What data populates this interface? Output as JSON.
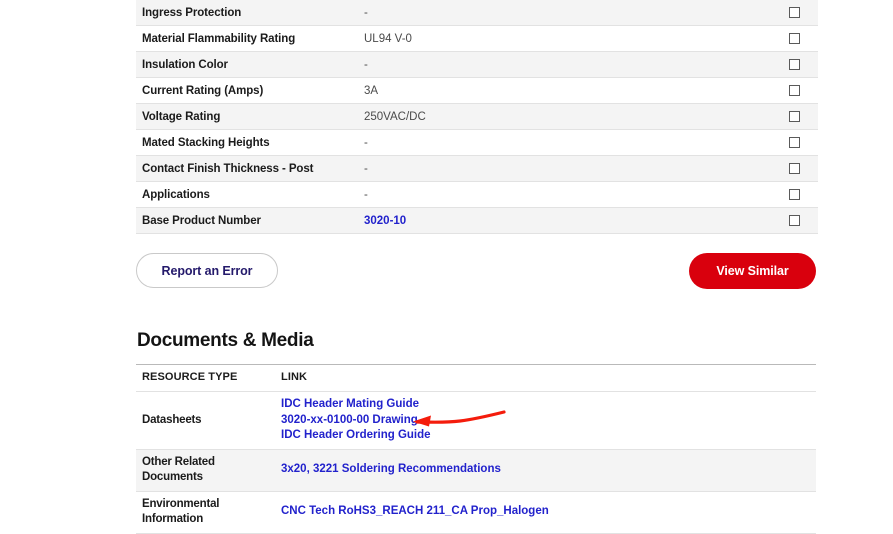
{
  "specifications": {
    "checkbox_icon": "checkbox-unchecked-icon",
    "rows": [
      {
        "label": "Ingress Protection",
        "value": "-",
        "is_link": false
      },
      {
        "label": "Material Flammability Rating",
        "value": "UL94 V-0",
        "is_link": false
      },
      {
        "label": "Insulation Color",
        "value": "-",
        "is_link": false
      },
      {
        "label": "Current Rating (Amps)",
        "value": "3A",
        "is_link": false
      },
      {
        "label": "Voltage Rating",
        "value": "250VAC/DC",
        "is_link": false
      },
      {
        "label": "Mated Stacking Heights",
        "value": "-",
        "is_link": false
      },
      {
        "label": "Contact Finish Thickness - Post",
        "value": "-",
        "is_link": false
      },
      {
        "label": "Applications",
        "value": "-",
        "is_link": false
      },
      {
        "label": "Base Product Number",
        "value": "3020-10",
        "is_link": true
      }
    ]
  },
  "actions": {
    "report_error_label": "Report an Error",
    "view_similar_label": "View Similar"
  },
  "documents": {
    "heading": "Documents & Media",
    "columns": {
      "resource_type": "RESOURCE TYPE",
      "link": "LINK"
    },
    "rows": [
      {
        "type": "Datasheets",
        "links": [
          "IDC Header Mating Guide",
          "3020-xx-0100-00 Drawing",
          "IDC Header Ordering Guide"
        ]
      },
      {
        "type": "Other Related Documents",
        "links": [
          "3x20, 3221 Soldering Recommendations"
        ]
      },
      {
        "type": "Environmental Information",
        "links": [
          "CNC Tech RoHS3_REACH 211_CA Prop_Halogen"
        ]
      }
    ]
  },
  "annotation": {
    "name": "red-arrow-annotation",
    "color": "#f41c0c",
    "points_to": "3020-xx-0100-00 Drawing"
  },
  "colors": {
    "link": "#2222cc",
    "primary_red": "#d9000d",
    "row_shade": "#f4f4f4",
    "text": "#1b1b1b",
    "annotation_red": "#f41c0c"
  }
}
